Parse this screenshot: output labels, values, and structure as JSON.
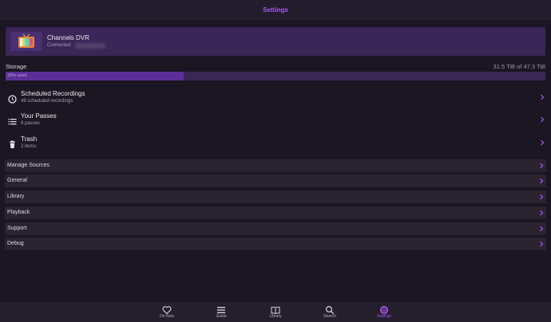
{
  "header": {
    "title": "Settings"
  },
  "server": {
    "name": "Channels DVR",
    "status_prefix": "Connected:"
  },
  "storage": {
    "label": "Storage",
    "value": "31.5 TiB of 47.3 TiB",
    "percent_label": "33% used",
    "fraction_used": 0.33
  },
  "list": [
    {
      "label": "Scheduled Recordings",
      "sub": "49 scheduled recordings",
      "icon": "clock-icon"
    },
    {
      "label": "Your Passes",
      "sub": "9 passes",
      "icon": "list-icon"
    },
    {
      "label": "Trash",
      "sub": "2 items",
      "icon": "trash-icon"
    }
  ],
  "sections": [
    {
      "label": "Manage Sources"
    },
    {
      "label": "General"
    },
    {
      "label": "Library"
    },
    {
      "label": "Playback"
    },
    {
      "label": "Support"
    },
    {
      "label": "Debug"
    }
  ],
  "tabs": [
    {
      "label": "On Now",
      "icon": "heart-icon"
    },
    {
      "label": "Guide",
      "icon": "menu-icon"
    },
    {
      "label": "Library",
      "icon": "book-icon"
    },
    {
      "label": "Search",
      "icon": "search-icon"
    },
    {
      "label": "Settings",
      "icon": "gear-icon",
      "active": true
    }
  ],
  "colors": {
    "accent": "#a75bf0",
    "background": "#1a1622",
    "card": "#3b2658",
    "storage_fill": "#5c2f98"
  }
}
